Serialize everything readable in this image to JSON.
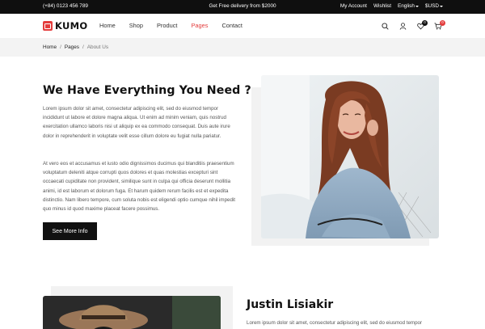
{
  "topbar": {
    "phone": "(+84) 0123 456 789",
    "promo": "Get Free delivery from $2000",
    "account": "My Account",
    "wishlist": "Wishlist",
    "language": "English",
    "currency": "$USD"
  },
  "header": {
    "brand": "KUMO",
    "nav": [
      "Home",
      "Shop",
      "Product",
      "Pages",
      "Contact"
    ],
    "active_nav": "Pages",
    "wishlist_count": "0",
    "cart_count": "0",
    "accent_color": "#e43d3d"
  },
  "breadcrumb": {
    "home": "Home",
    "pages": "Pages",
    "current": "About Us",
    "separator": "/"
  },
  "about": {
    "title": "We Have Everything You Need ?",
    "paragraph1": "Lorem ipsum dolor sit amet, consectetur adipiscing elit, sed do eiusmod tempor incididunt ut labore et dolore magna aliqua. Ut enim ad minim veniam, quis nostrud exercitation ullamco laboris nisi ut aliquip ex ea commodo consequat. Duis aute irure dolor in reprehenderit in voluptate velit esse cillum dolore eu fugiat nulla pariatur.",
    "paragraph2": "At vero eos et accusamus et iusto odio dignissimos ducimus qui blanditiis praesentium voluptatum deleniti atque corrupti quos dolores et quas molestias excepturi sint occaecati cupiditate non provident, similique sunt in culpa qui officia deserunt mollitia animi, id est laborum et dolorum fuga. Et harum quidem rerum facilis est et expedita distinctio. Nam libero tempore, cum soluta nobis est eligendi optio cumque nihil impedit quo minus id quod maxime placeat facere possimus.",
    "button": "See More Info"
  },
  "profile": {
    "name": "Justin Lisiakir",
    "paragraph": "Lorem ipsum dolor sit amet, consectetur adipiscing elit, sed do eiusmod tempor"
  }
}
